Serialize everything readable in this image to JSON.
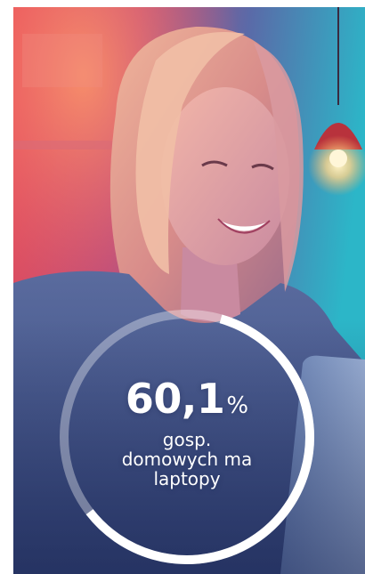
{
  "stat": {
    "number": "60,1",
    "unit": "%",
    "caption": "gosp. domowych ma laptopy",
    "progress_fraction": 0.601
  },
  "photo": {
    "icon": "woman-using-laptop-photo"
  },
  "colors": {
    "ring": "#ffffff",
    "text": "#ffffff",
    "neon_red": "#e8445a",
    "teal": "#2fb7c9",
    "sweater_blue": "#4a5f94"
  }
}
